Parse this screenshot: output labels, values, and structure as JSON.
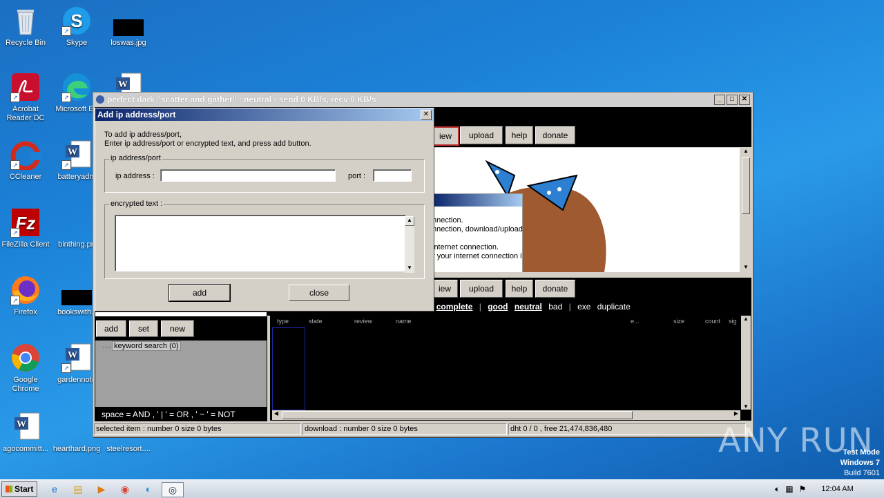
{
  "desktop": {
    "icons": [
      {
        "label": "Recycle Bin",
        "icon": "recycle-bin-icon"
      },
      {
        "label": "Skype",
        "icon": "skype-icon"
      },
      {
        "label": "loswas.jpg",
        "icon": "image-file-icon"
      },
      {
        "label": "Acrobat Reader DC",
        "icon": "acrobat-icon"
      },
      {
        "label": "Microsoft Ed",
        "icon": "edge-icon"
      },
      {
        "label": "CCleaner",
        "icon": "ccleaner-icon"
      },
      {
        "label": "batteryadm",
        "icon": "word-doc-icon"
      },
      {
        "label": "FileZilla Client",
        "icon": "filezilla-icon"
      },
      {
        "label": "binthing.pn",
        "icon": "image-file-icon"
      },
      {
        "label": "Firefox",
        "icon": "firefox-icon"
      },
      {
        "label": "bookswith.r",
        "icon": "image-file-icon"
      },
      {
        "label": "Google Chrome",
        "icon": "chrome-icon"
      },
      {
        "label": "gardennote",
        "icon": "word-doc-icon"
      },
      {
        "label": "agocommitt...",
        "icon": "word-doc-icon"
      },
      {
        "label": "hearthard.png",
        "icon": "image-file-icon"
      },
      {
        "label": "steelresort....",
        "icon": "word-doc-icon"
      }
    ]
  },
  "main_window": {
    "title": "perfect dark \"scatter and gather\" : neutral - send   0 KB/s, recv   0 KB/s",
    "top_buttons": [
      "iew",
      "upload",
      "help",
      "donate"
    ],
    "mid_buttons": [
      "iew",
      "upload",
      "help",
      "donate"
    ],
    "behind_dialog_text": [
      "nnection.",
      "nnection, download/upload",
      "internet connection.",
      "r your internet connection i"
    ],
    "filters": [
      "d",
      "complete",
      "good",
      "neutral",
      "bad",
      "exe",
      "duplicate"
    ],
    "columns": [
      "type",
      "state",
      "review",
      "name",
      "e...",
      "size",
      "count",
      "sig"
    ],
    "left_buttons": [
      "add",
      "set",
      "new"
    ],
    "tree_item": "keyword search (0)",
    "search_hint": "space = AND , ' | ' = OR , ' ~ ' = NOT",
    "status": {
      "selected": "selected item : number 0  size 0 bytes",
      "download": "download : number 0  size 0 bytes",
      "dht": "dht 0 / 0 , free 21,474,836,480"
    }
  },
  "dialog": {
    "title": "Add ip address/port",
    "instructions_1": "To add ip address/port,",
    "instructions_2": "Enter ip address/port or encrypted text, and press add button.",
    "group_ip": "ip address/port",
    "ip_label": "ip address :",
    "ip_value": "",
    "port_label": "port :",
    "port_value": "",
    "group_encrypted": "encrypted text :",
    "encrypted_value": "",
    "add_label": "add",
    "close_label": "close"
  },
  "watermark": {
    "brand": "ANY RUN",
    "line1": "Test Mode",
    "line2": "Windows 7",
    "line3": "Build 7601"
  },
  "taskbar": {
    "start_label": "Start",
    "clock": "12:04 AM"
  }
}
